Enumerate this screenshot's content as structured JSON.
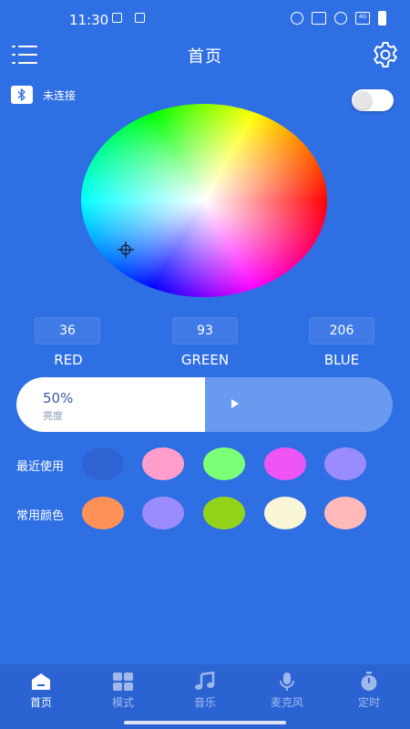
{
  "status_bar": {
    "time": "11:30",
    "network_label": "4G"
  },
  "header": {
    "title": "首页",
    "menu_icon": "list-menu-icon",
    "settings_icon": "gear-icon"
  },
  "connection": {
    "icon": "bluetooth-icon",
    "status": "未连接",
    "toggle_on": false
  },
  "color_wheel": {
    "cursor_icon": "crosshair-icon"
  },
  "rgb": {
    "red_value": "36",
    "green_value": "93",
    "blue_value": "206",
    "red_label": "RED",
    "green_label": "GREEN",
    "blue_label": "BLUE"
  },
  "brightness": {
    "value_text": "50%",
    "label": "亮度",
    "level_percent": 50
  },
  "recent_colors": {
    "label": "最近使用",
    "colors": [
      "#2f63d4",
      "#ff9ecb",
      "#7bff77",
      "#ee55f5",
      "#9a8cff"
    ]
  },
  "common_colors": {
    "label": "常用颜色",
    "colors": [
      "#ff9157",
      "#9a8cff",
      "#93d41a",
      "#f8f6d6",
      "#ffb9b9"
    ]
  },
  "bottom_nav": {
    "items": [
      {
        "label": "首页",
        "icon": "home-icon",
        "active": true
      },
      {
        "label": "模式",
        "icon": "grid-icon",
        "active": false
      },
      {
        "label": "音乐",
        "icon": "music-note-icon",
        "active": false
      },
      {
        "label": "麦克风",
        "icon": "microphone-icon",
        "active": false
      },
      {
        "label": "定时",
        "icon": "timer-icon",
        "active": false
      }
    ]
  },
  "colors": {
    "background": "#2f6fe4",
    "nav_background": "#2b63d3",
    "brightness_track": "#6a9af0"
  }
}
